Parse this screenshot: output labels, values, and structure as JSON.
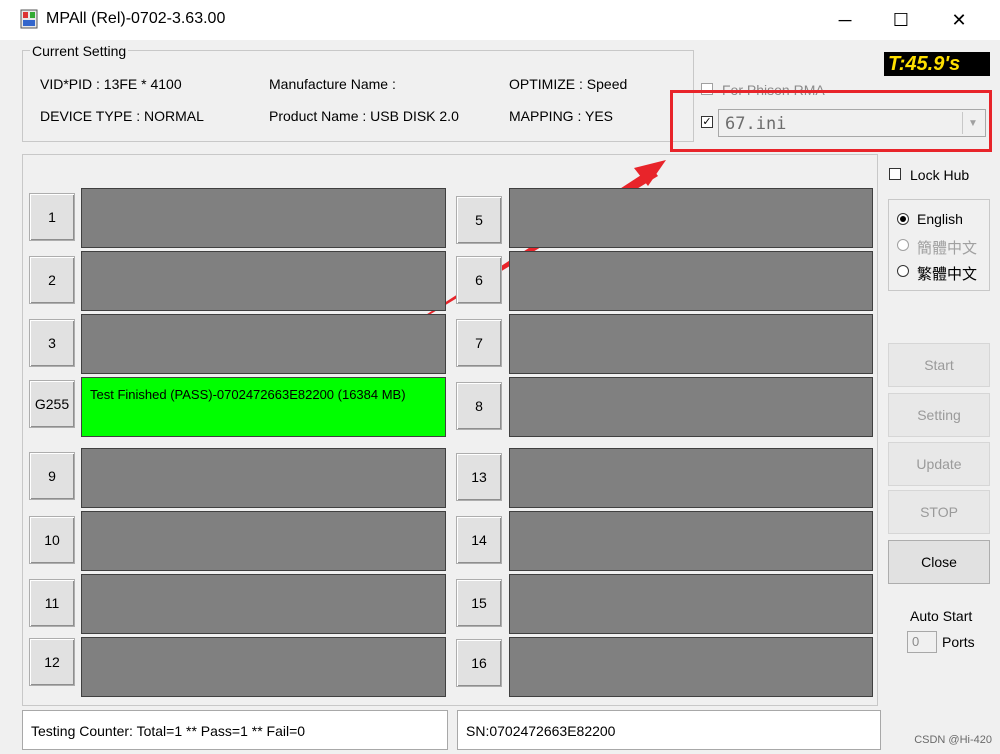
{
  "window": {
    "title": "MPAll (Rel)-0702-3.63.00",
    "minimize_glyph": "─",
    "maximize_glyph": "☐",
    "close_glyph": "✕"
  },
  "current_setting": {
    "legend": "Current Setting",
    "vid_pid": "VID*PID : 13FE * 4100",
    "device_type": "DEVICE TYPE : NORMAL",
    "manufacture_name": "Manufacture Name :",
    "product_name": "Product Name : USB DISK 2.0",
    "optimize": "OPTIMIZE : Speed",
    "mapping": "MAPPING : YES"
  },
  "timer": "T:45.9's",
  "rma": {
    "label": "For Phison RMA",
    "checked": false
  },
  "ini": {
    "checked": true,
    "value": "67.ini"
  },
  "lock_hub": {
    "label": "Lock Hub",
    "checked": false
  },
  "language": {
    "options": [
      {
        "label": "English",
        "selected": true,
        "enabled": true
      },
      {
        "label": "簡體中文",
        "selected": false,
        "enabled": false
      },
      {
        "label": "繁體中文",
        "selected": false,
        "enabled": true
      }
    ]
  },
  "buttons": {
    "start": "Start",
    "setting": "Setting",
    "update": "Update",
    "stop": "STOP",
    "close": "Close"
  },
  "auto_start": {
    "label": "Auto Start",
    "value": "0",
    "suffix": "Ports"
  },
  "ports": [
    {
      "label": "1",
      "status": ""
    },
    {
      "label": "2",
      "status": ""
    },
    {
      "label": "3",
      "status": ""
    },
    {
      "label": "G255",
      "status": "Test Finished (PASS)-0702472663E82200 (16384 MB)"
    },
    {
      "label": "5",
      "status": ""
    },
    {
      "label": "6",
      "status": ""
    },
    {
      "label": "7",
      "status": ""
    },
    {
      "label": "8",
      "status": ""
    },
    {
      "label": "9",
      "status": ""
    },
    {
      "label": "10",
      "status": ""
    },
    {
      "label": "11",
      "status": ""
    },
    {
      "label": "12",
      "status": ""
    },
    {
      "label": "13",
      "status": ""
    },
    {
      "label": "14",
      "status": ""
    },
    {
      "label": "15",
      "status": ""
    },
    {
      "label": "16",
      "status": ""
    }
  ],
  "status": {
    "counter": "Testing Counter: Total=1 ** Pass=1 ** Fail=0",
    "sn": "SN:0702472663E82200"
  },
  "watermark": "CSDN @Hi-420",
  "colors": {
    "pass": "#00ff00",
    "idle": "#808080",
    "timer_text": "#ffe000",
    "annotation": "#e8242a"
  }
}
